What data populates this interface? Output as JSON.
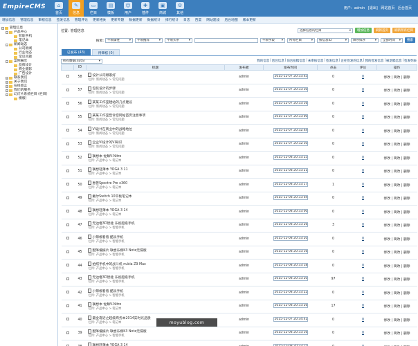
{
  "header": {
    "logo": "EmpireCMS",
    "nav": [
      {
        "label": "首页",
        "icon": "home-icon",
        "active": false
      },
      {
        "label": "信息",
        "icon": "pencil-icon",
        "active": true
      },
      {
        "label": "栏目",
        "icon": "folder-icon",
        "active": false
      },
      {
        "label": "模板",
        "icon": "template-icon",
        "active": false
      },
      {
        "label": "用户",
        "icon": "user-icon",
        "active": false
      },
      {
        "label": "插件",
        "icon": "plugin-icon",
        "active": false
      },
      {
        "label": "商城",
        "icon": "shop-icon",
        "active": false
      },
      {
        "label": "其他",
        "icon": "settings-icon",
        "active": false
      }
    ],
    "user_label": "用户:",
    "username": "admin",
    "logout": "[退出]",
    "site": "网站首页",
    "backend": "后台首页"
  },
  "subnav": [
    "增加信息",
    "管理信息",
    "审核信息",
    "签发信息",
    "管理评论",
    "更新相关",
    "更新专题",
    "数据更新",
    "数据统计",
    "排行统计",
    "日志",
    "百度",
    "网站建设",
    "后台地图",
    "版本更新"
  ],
  "sidebar": {
    "items": [
      {
        "label": "管理信息",
        "level": 0,
        "type": "root"
      },
      {
        "label": "产品中心",
        "level": 1,
        "type": "folder",
        "expanded": true
      },
      {
        "label": "智能手机",
        "level": 2,
        "type": "leaf"
      },
      {
        "label": "笔记本",
        "level": 2,
        "type": "leaf"
      },
      {
        "label": "新闻动态",
        "level": 1,
        "type": "folder",
        "expanded": true
      },
      {
        "label": "公司新闻",
        "level": 2,
        "type": "leaf"
      },
      {
        "label": "行业动态",
        "level": 2,
        "type": "leaf"
      },
      {
        "label": "常见问题",
        "level": 2,
        "type": "leaf"
      },
      {
        "label": "案例展示",
        "level": 1,
        "type": "folder",
        "expanded": true
      },
      {
        "label": "品牌设计",
        "level": 2,
        "type": "leaf"
      },
      {
        "label": "商业摄影",
        "level": 2,
        "type": "leaf"
      },
      {
        "label": "广告设计",
        "level": 2,
        "type": "leaf"
      },
      {
        "label": "联系我们",
        "level": 1,
        "type": "folder",
        "expanded": false
      },
      {
        "label": "关于我们",
        "level": 1,
        "type": "folder",
        "expanded": false
      },
      {
        "label": "在线留言",
        "level": 1,
        "type": "folder",
        "expanded": false
      },
      {
        "label": "我们的服务",
        "level": 1,
        "type": "folder",
        "expanded": false
      },
      {
        "label": "幻灯片系统栏目 (栏目)",
        "level": 1,
        "type": "folder",
        "expanded": false
      },
      {
        "label": "模版)",
        "level": 2,
        "type": "leaf"
      }
    ]
  },
  "location": {
    "label": "位置:",
    "text": "管理信息",
    "column_select": "选择信息的栏目",
    "add_button": "增加信息",
    "refresh_button": "刷新首页",
    "refresh_all_button": "刷新所有栏目"
  },
  "search": {
    "label": "搜索:",
    "selects": [
      "不限属性",
      "不限推荐",
      "不限头条",
      "不限字段",
      "所有栏目",
      "按信息ID",
      "降序排序",
      "全部时间"
    ],
    "button": "搜索"
  },
  "tabs": [
    {
      "label": "已发布 (43)",
      "active": true
    },
    {
      "label": "待审核 (0)",
      "active": false
    }
  ],
  "filter": {
    "select": "所有数据(data)",
    "links": [
      "我的信息",
      "|",
      "后台信息",
      "|",
      "前台投稿信息",
      "|",
      "未审核信息",
      "|",
      "签发信息",
      "|",
      "正在签发的信息",
      "|",
      "我的签发信息",
      "|",
      "被退稿信息",
      "|",
      "签发列表"
    ]
  },
  "table": {
    "columns": [
      "",
      "ID",
      "标题",
      "发布者",
      "发布时间",
      "点击",
      "评论",
      "操作"
    ],
    "rows": [
      {
        "id": "58",
        "title": "设计公司哪家好",
        "column": "栏目: 新闻动态 > 常见问题",
        "author": "admin",
        "time": "2015-12-07 20:33:45",
        "hits": "0",
        "comments": "0",
        "ops": "修改 | 简改 | 删除"
      },
      {
        "id": "57",
        "title": "包装设计的步骤",
        "column": "栏目: 新闻动态 > 常见问题",
        "author": "admin",
        "time": "2015-12-07 20:33:30",
        "hits": "0",
        "comments": "0",
        "ops": "修改 | 简改 | 删除"
      },
      {
        "id": "56",
        "title": "某某工作室建站的几点建议",
        "column": "栏目: 新闻动态 > 常见问题",
        "author": "admin",
        "time": "2015-12-07 20:33:16",
        "hits": "0",
        "comments": "0",
        "ops": "修改 | 简改 | 删除"
      },
      {
        "id": "55",
        "title": "某某工作室告诉您网站首页注意事项",
        "column": "栏目: 新闻动态 > 常见问题",
        "author": "admin",
        "time": "2015-12-07 20:33:00",
        "hits": "0",
        "comments": "0",
        "ops": "修改 | 简改 | 删除"
      },
      {
        "id": "54",
        "title": "VI设计在商业中的战略地位",
        "column": "栏目: 新闻动态 > 常见问题",
        "author": "admin",
        "time": "2015-12-07 20:32:44",
        "hits": "0",
        "comments": "0",
        "ops": "修改 | 简改 | 删除"
      },
      {
        "id": "53",
        "title": "企业VI设计的VI知识",
        "column": "栏目: 新闻动态 > 常见问题",
        "author": "admin",
        "time": "2015-12-07 20:32:30",
        "hits": "0",
        "comments": "0",
        "ops": "修改 | 简改 | 删除"
      },
      {
        "id": "52",
        "title": "联想本 佐臻V-Nitro",
        "column": "栏目: 产品中心 > 笔记本",
        "author": "admin",
        "time": "2015-12-08 20:33:25",
        "hits": "0",
        "comments": "0",
        "ops": "修改 | 简改 | 删除"
      },
      {
        "id": "51",
        "title": "联想轻薄本 YOGA 3 11",
        "column": "栏目: 产品中心 > 笔记本",
        "author": "admin",
        "time": "2015-12-08 20:33:21",
        "hits": "0",
        "comments": "0",
        "ops": "修改 | 简改 | 删除"
      },
      {
        "id": "50",
        "title": "惠普Spectre Pro x360",
        "column": "栏目: 产品中心 > 笔记本",
        "author": "admin",
        "time": "2015-12-08 20:33:17",
        "hits": "1",
        "comments": "0",
        "ops": "修改 | 简改 | 删除"
      },
      {
        "id": "49",
        "title": "戴尔Switch 10平板笔记本",
        "column": "栏目: 产品中心 > 笔记本",
        "author": "admin",
        "time": "2015-12-08 20:33:04",
        "hits": "0",
        "comments": "0",
        "ops": "修改 | 简改 | 删除"
      },
      {
        "id": "48",
        "title": "联想轻薄本 YOGA 3 14",
        "column": "栏目: 产品中心 > 笔记本",
        "author": "admin",
        "time": "2015-12-08 20:33:00",
        "hits": "0",
        "comments": "0",
        "ops": "修改 | 简改 | 删除"
      },
      {
        "id": "47",
        "title": "无边框3D智能 乐视超级手机",
        "column": "栏目: 产品中心 > 智能手机",
        "author": "admin",
        "time": "2015-12-08 20:33:26",
        "hits": "3",
        "comments": "0",
        "ops": "修改 | 简改 | 删除"
      },
      {
        "id": "46",
        "title": "小辣椒看看 酷派手机",
        "column": "栏目: 产品中心 > 智能手机",
        "author": "admin",
        "time": "2015-12-08 20:33:20",
        "hits": "0",
        "comments": "0",
        "ops": "修改 | 简改 | 删除"
      },
      {
        "id": "45",
        "title": "配降偏振片 联想乐檬K3 Note无漏版",
        "column": "栏目: 产品中心 > 智能手机",
        "author": "admin",
        "time": "2015-12-08 20:33:16",
        "hits": "0",
        "comments": "0",
        "ops": "修改 | 简改 | 删除"
      },
      {
        "id": "44",
        "title": "拍照手机中的战斗机 nubia Z9 Max",
        "column": "栏目: 产品中心 > 智能手机",
        "author": "admin",
        "time": "2015-12-08 20:33:18",
        "hits": "0",
        "comments": "0",
        "ops": "修改 | 简改 | 删除"
      },
      {
        "id": "43",
        "title": "无边框3D智能 乐视超级手机",
        "column": "栏目: 产品中心 > 智能手机",
        "author": "admin",
        "time": "2015-12-08 20:33:20",
        "hits": "97",
        "comments": "0",
        "ops": "修改 | 简改 | 删除"
      },
      {
        "id": "42",
        "title": "小辣椒看看 酷派手机",
        "column": "栏目: 产品中心 > 智能手机",
        "author": "admin",
        "time": "2015-12-08 20:33:22",
        "hits": "0",
        "comments": "0",
        "ops": "修改 | 简改 | 删除"
      },
      {
        "id": "41",
        "title": "联想本 佐臻V-Nitro",
        "column": "栏目: 产品中心 > 笔记本",
        "author": "admin",
        "time": "2015-12-08 20:33:26",
        "hits": "17",
        "comments": "0",
        "ops": "修改 | 简改 | 删除"
      },
      {
        "id": "40",
        "title": "最全靠近之超级商务本2014实时光品质",
        "column": "栏目: 产品中心 > 笔记本",
        "author": "admin",
        "time": "2015-12-07 20:34:41",
        "hits": "0",
        "comments": "0",
        "ops": "修改 | 简改 | 删除"
      },
      {
        "id": "39",
        "title": "配降偏振片 联想乐檬K3 Note无漏版",
        "column": "栏目: 产品中心 > 智能手机",
        "author": "admin",
        "time": "2015-12-08 20:33:16",
        "hits": "0",
        "comments": "0",
        "ops": "修改 | 简改 | 删除"
      },
      {
        "id": "38",
        "title": "联想轻薄本 YOGA 3 14",
        "column": "栏目: 产品中心 > 笔记本",
        "author": "admin",
        "time": "2015-12-08 20:33:15",
        "hits": "0",
        "comments": "0",
        "ops": "修改 | 简改 | 删除"
      }
    ]
  },
  "watermark": "moyublog.com"
}
